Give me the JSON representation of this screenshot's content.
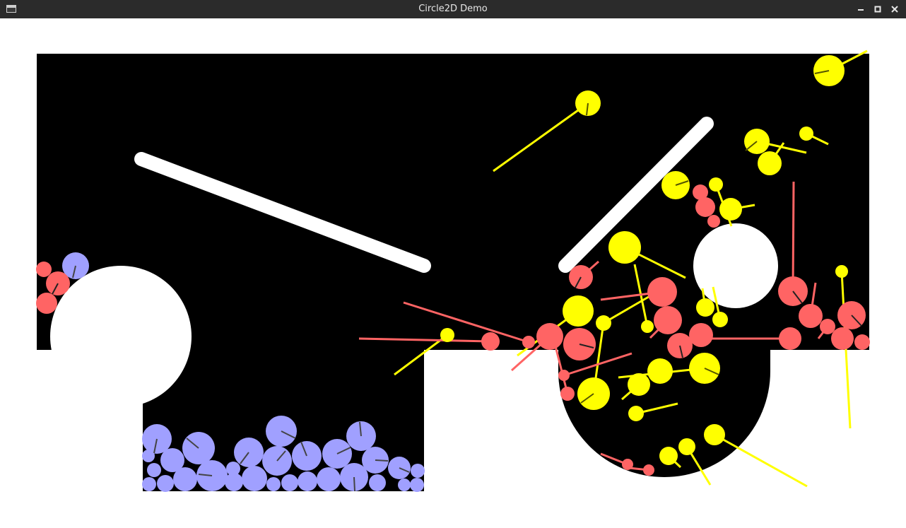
{
  "window": {
    "title": "Circle2D Demo",
    "controls": [
      "minimize",
      "maximize",
      "close"
    ]
  },
  "colors": {
    "titlebar": "#2b2b2b",
    "title_text": "#e6e6e6",
    "background": "#ffffff",
    "arena": "#000000",
    "obstacle": "#ffffff",
    "ball_blue": "#a0a0ff",
    "ball_red": "#ff6464",
    "ball_yellow": "#ffff00",
    "trail_red": "#ff6464",
    "trail_yellow": "#ffff00"
  },
  "icons": {
    "app": "window-app-icon",
    "minimize": "minimize-icon",
    "maximize": "maximize-icon",
    "close": "close-icon"
  }
}
